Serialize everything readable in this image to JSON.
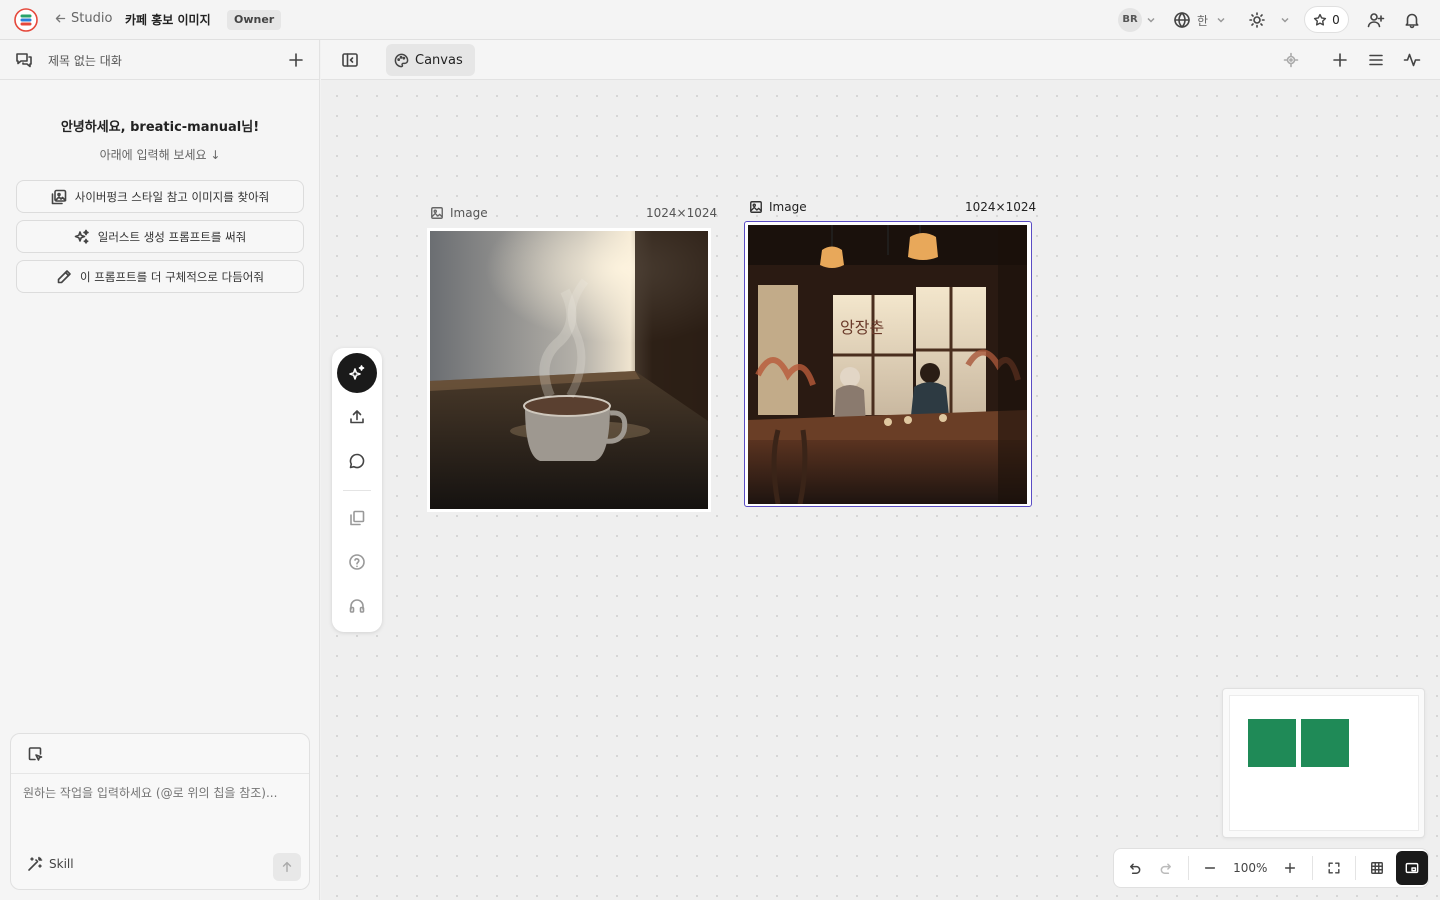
{
  "header": {
    "back_label": "Studio",
    "project_title": "카페 홍보 이미지",
    "role_badge": "Owner",
    "avatar_initials": "BR",
    "language": "한",
    "star_count": "0"
  },
  "sidebar": {
    "conversation_title": "제목 없는 대화",
    "greeting": "안녕하세요, breatic-manual님!",
    "subgreeting": "아래에 입력해 보세요 ↓",
    "suggestions": [
      {
        "label": "사이버펑크 스타일 참고 이미지를 찾아줘",
        "icon": "image-search-icon"
      },
      {
        "label": "일러스트 생성 프롬프트를 써줘",
        "icon": "sparkles-icon"
      },
      {
        "label": "이 프롬프트를 더 구체적으로 다듬어줘",
        "icon": "pencil-icon"
      }
    ],
    "composer": {
      "placeholder": "원하는 작업을 입력하세요 (@로 위의 칩을 참조)...",
      "skill_label": "Skill"
    }
  },
  "tabs": {
    "active_tab": "Canvas"
  },
  "canvas": {
    "nodes": [
      {
        "type_label": "Image",
        "size_label": "1024×1024",
        "subject": "coffee cup by window"
      },
      {
        "type_label": "Image",
        "size_label": "1024×1024",
        "subject": "cafe interior",
        "selected": true,
        "sign_text": "앙장춘"
      }
    ],
    "zoom_level": "100%"
  },
  "colors": {
    "accent_selection": "#5a4cc4",
    "minimap_block": "#1f8a57",
    "primary_button": "#1a1a1a"
  }
}
